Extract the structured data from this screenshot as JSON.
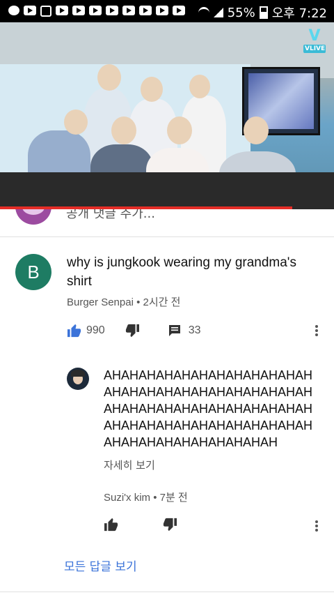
{
  "status_bar": {
    "battery": "55%",
    "time": "오후 7:22",
    "icons": [
      "bubble-icon",
      "play-icon",
      "doc-icon",
      "play-icon",
      "play-icon",
      "play-icon",
      "play-icon",
      "play-icon",
      "play-icon",
      "play-icon",
      "play-icon"
    ]
  },
  "video": {
    "badge_label": "VLIVE",
    "progress": 0.875
  },
  "previous_comment": {
    "placeholder": "공개 댓글 추가..."
  },
  "comment": {
    "avatar_letter": "B",
    "avatar_color": "#1e7c63",
    "text": "why is jungkook wearing my grandma's shirt",
    "author_line": "Burger Senpai • 2시간 전",
    "likes": "990",
    "replies": "33",
    "accent_like": "#3b73d9"
  },
  "reply": {
    "text": "AHAHAHAHAHAHAHAHAHAHAHAHAHAHAHAHAHAHAHAHAHAHAHAHAHAHAHAHAHAHAHAHAHAHAHAHAHAHAHAHAHAHAHAHAHAHAHAHAHAHAHAHAHAHAHAHAHAH",
    "read_more": "자세히 보기",
    "author_line": "Suzi'x kim • 7분 전"
  },
  "view_all_replies": "모든 답글 보기"
}
